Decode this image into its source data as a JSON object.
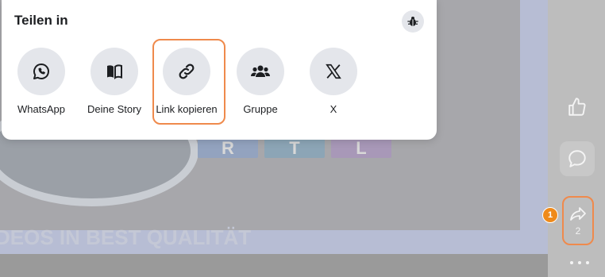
{
  "share_panel": {
    "title": "Teilen in",
    "options": [
      {
        "label": "WhatsApp",
        "icon": "whatsapp-icon"
      },
      {
        "label": "Deine Story",
        "icon": "book-icon"
      },
      {
        "label": "Link kopieren",
        "icon": "link-icon"
      },
      {
        "label": "Gruppe",
        "icon": "group-icon"
      },
      {
        "label": "X",
        "icon": "x-logo-icon"
      }
    ],
    "debug_icon": "bug-icon"
  },
  "background": {
    "tile_letters": [
      "R",
      "T",
      "L"
    ],
    "banner_text": "DEOS IN BEST QUALITÄT"
  },
  "rail": {
    "share_count": "2",
    "step_badge": "1"
  },
  "colors": {
    "highlight": "#ef8a4c",
    "badge": "#ef8a1a",
    "panel_bg": "#ffffff",
    "icon_circle": "#e4e6eb"
  }
}
